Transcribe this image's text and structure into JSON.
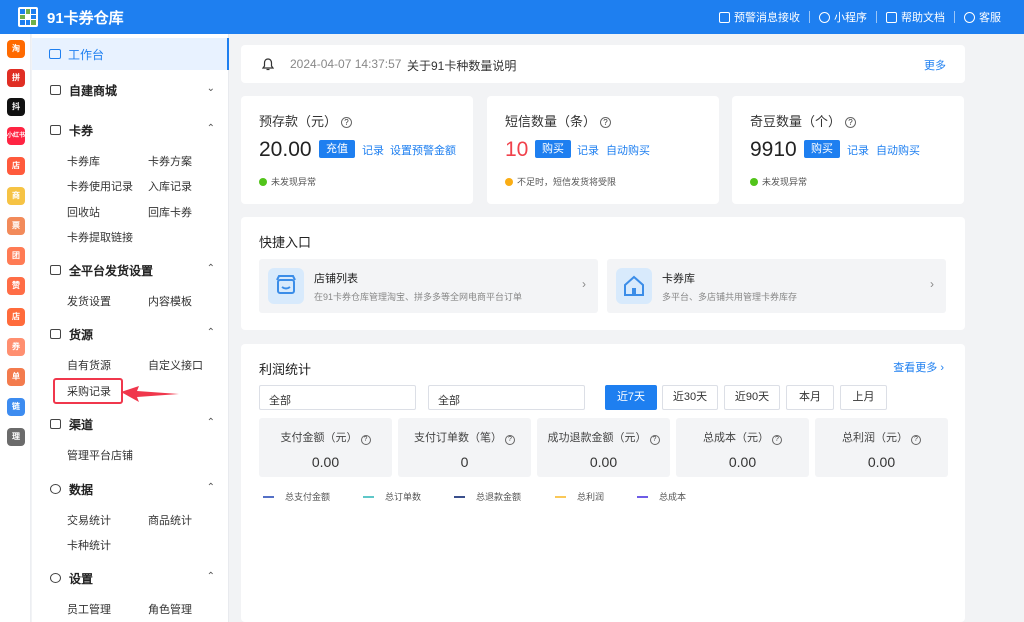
{
  "header": {
    "app_title": "91卡券仓库",
    "links": [
      "预警消息接收",
      "小程序",
      "帮助文档",
      "客服"
    ]
  },
  "app_strip": [
    {
      "name": "taobao-icon",
      "label": "淘",
      "color": "#ff6a00"
    },
    {
      "name": "pinduoduo-icon",
      "label": "拼",
      "color": "#e02e24"
    },
    {
      "name": "douyin-icon",
      "label": "抖",
      "color": "#111111"
    },
    {
      "name": "xiaohongshu-icon",
      "label": "小红书",
      "color": "#ff2442"
    },
    {
      "name": "shop-orange-icon",
      "label": "店",
      "color": "#ff5a3c"
    },
    {
      "name": "yellow-app-icon",
      "label": "商",
      "color": "#f6c344"
    },
    {
      "name": "ticket-app-icon",
      "label": "票",
      "color": "#f28a5a"
    },
    {
      "name": "group-app-icon",
      "label": "团",
      "color": "#ff7b54"
    },
    {
      "name": "thumb-app-icon",
      "label": "赞",
      "color": "#ff6d46"
    },
    {
      "name": "store-app-icon",
      "label": "店",
      "color": "#ff6b3b"
    },
    {
      "name": "coupon-app-icon",
      "label": "券",
      "color": "#ff8f70"
    },
    {
      "name": "orange-app-icon",
      "label": "单",
      "color": "#f37b4d"
    },
    {
      "name": "link-app-icon",
      "label": "链",
      "color": "#3d8cf0"
    },
    {
      "name": "gray-app-icon",
      "label": "理",
      "color": "#6b6b6b"
    }
  ],
  "sidebar": {
    "active": "工作台",
    "sections": [
      {
        "title": "自建商城",
        "items": []
      },
      {
        "title": "卡券",
        "items": [
          "卡券库",
          "卡券方案",
          "卡券使用记录",
          "入库记录",
          "回收站",
          "回库卡券",
          "卡券提取链接"
        ]
      },
      {
        "title": "全平台发货设置",
        "items": [
          "发货设置",
          "内容模板"
        ]
      },
      {
        "title": "货源",
        "items": [
          "自有货源",
          "自定义接口",
          "采购记录"
        ]
      },
      {
        "title": "渠道",
        "items": [
          "管理平台店铺"
        ]
      },
      {
        "title": "数据",
        "items": [
          "交易统计",
          "商品统计",
          "卡种统计"
        ]
      },
      {
        "title": "设置",
        "items": [
          "员工管理",
          "角色管理"
        ]
      }
    ]
  },
  "notice": {
    "time": "2024-04-07 14:37:57",
    "text": "关于91卡种数量说明",
    "more": "更多"
  },
  "stats": [
    {
      "title": "预存款（元）",
      "value": "20.00",
      "button": "充值",
      "links": [
        "记录",
        "设置预警金额"
      ],
      "status": "未发现异常",
      "status_color": "#52c41a",
      "value_color": "#222222"
    },
    {
      "title": "短信数量（条）",
      "value": "10",
      "button": "购买",
      "links": [
        "记录",
        "自动购买"
      ],
      "status": "不足时，短信发货将受限",
      "status_color": "#faad14",
      "value_color": "#f0414b"
    },
    {
      "title": "奇豆数量（个）",
      "value": "9910",
      "button": "购买",
      "links": [
        "记录",
        "自动购买"
      ],
      "status": "未发现异常",
      "status_color": "#52c41a",
      "value_color": "#222222"
    }
  ],
  "quick": {
    "title": "快捷入口",
    "items": [
      {
        "name": "店铺列表",
        "desc": "在91卡券仓库管理淘宝、拼多多等全网电商平台订单"
      },
      {
        "name": "卡券库",
        "desc": "多平台、多店铺共用管理卡券库存"
      }
    ]
  },
  "profit": {
    "title": "利润统计",
    "more": "查看更多",
    "selects": [
      "全部",
      "全部"
    ],
    "ranges": [
      "近7天",
      "近30天",
      "近90天",
      "本月",
      "上月"
    ],
    "active_range": "近7天",
    "metrics": [
      {
        "label": "支付金额（元）",
        "value": "0.00"
      },
      {
        "label": "支付订单数（笔）",
        "value": "0"
      },
      {
        "label": "成功退款金额（元）",
        "value": "0.00"
      },
      {
        "label": "总成本（元）",
        "value": "0.00"
      },
      {
        "label": "总利润（元）",
        "value": "0.00"
      }
    ],
    "legend": [
      {
        "label": "总支付金额",
        "color": "#5470c6"
      },
      {
        "label": "总订单数",
        "color": "#5fc7c8"
      },
      {
        "label": "总退款金额",
        "color": "#3a4f8c"
      },
      {
        "label": "总利润",
        "color": "#fac858"
      },
      {
        "label": "总成本",
        "color": "#6e5ce6"
      }
    ]
  }
}
